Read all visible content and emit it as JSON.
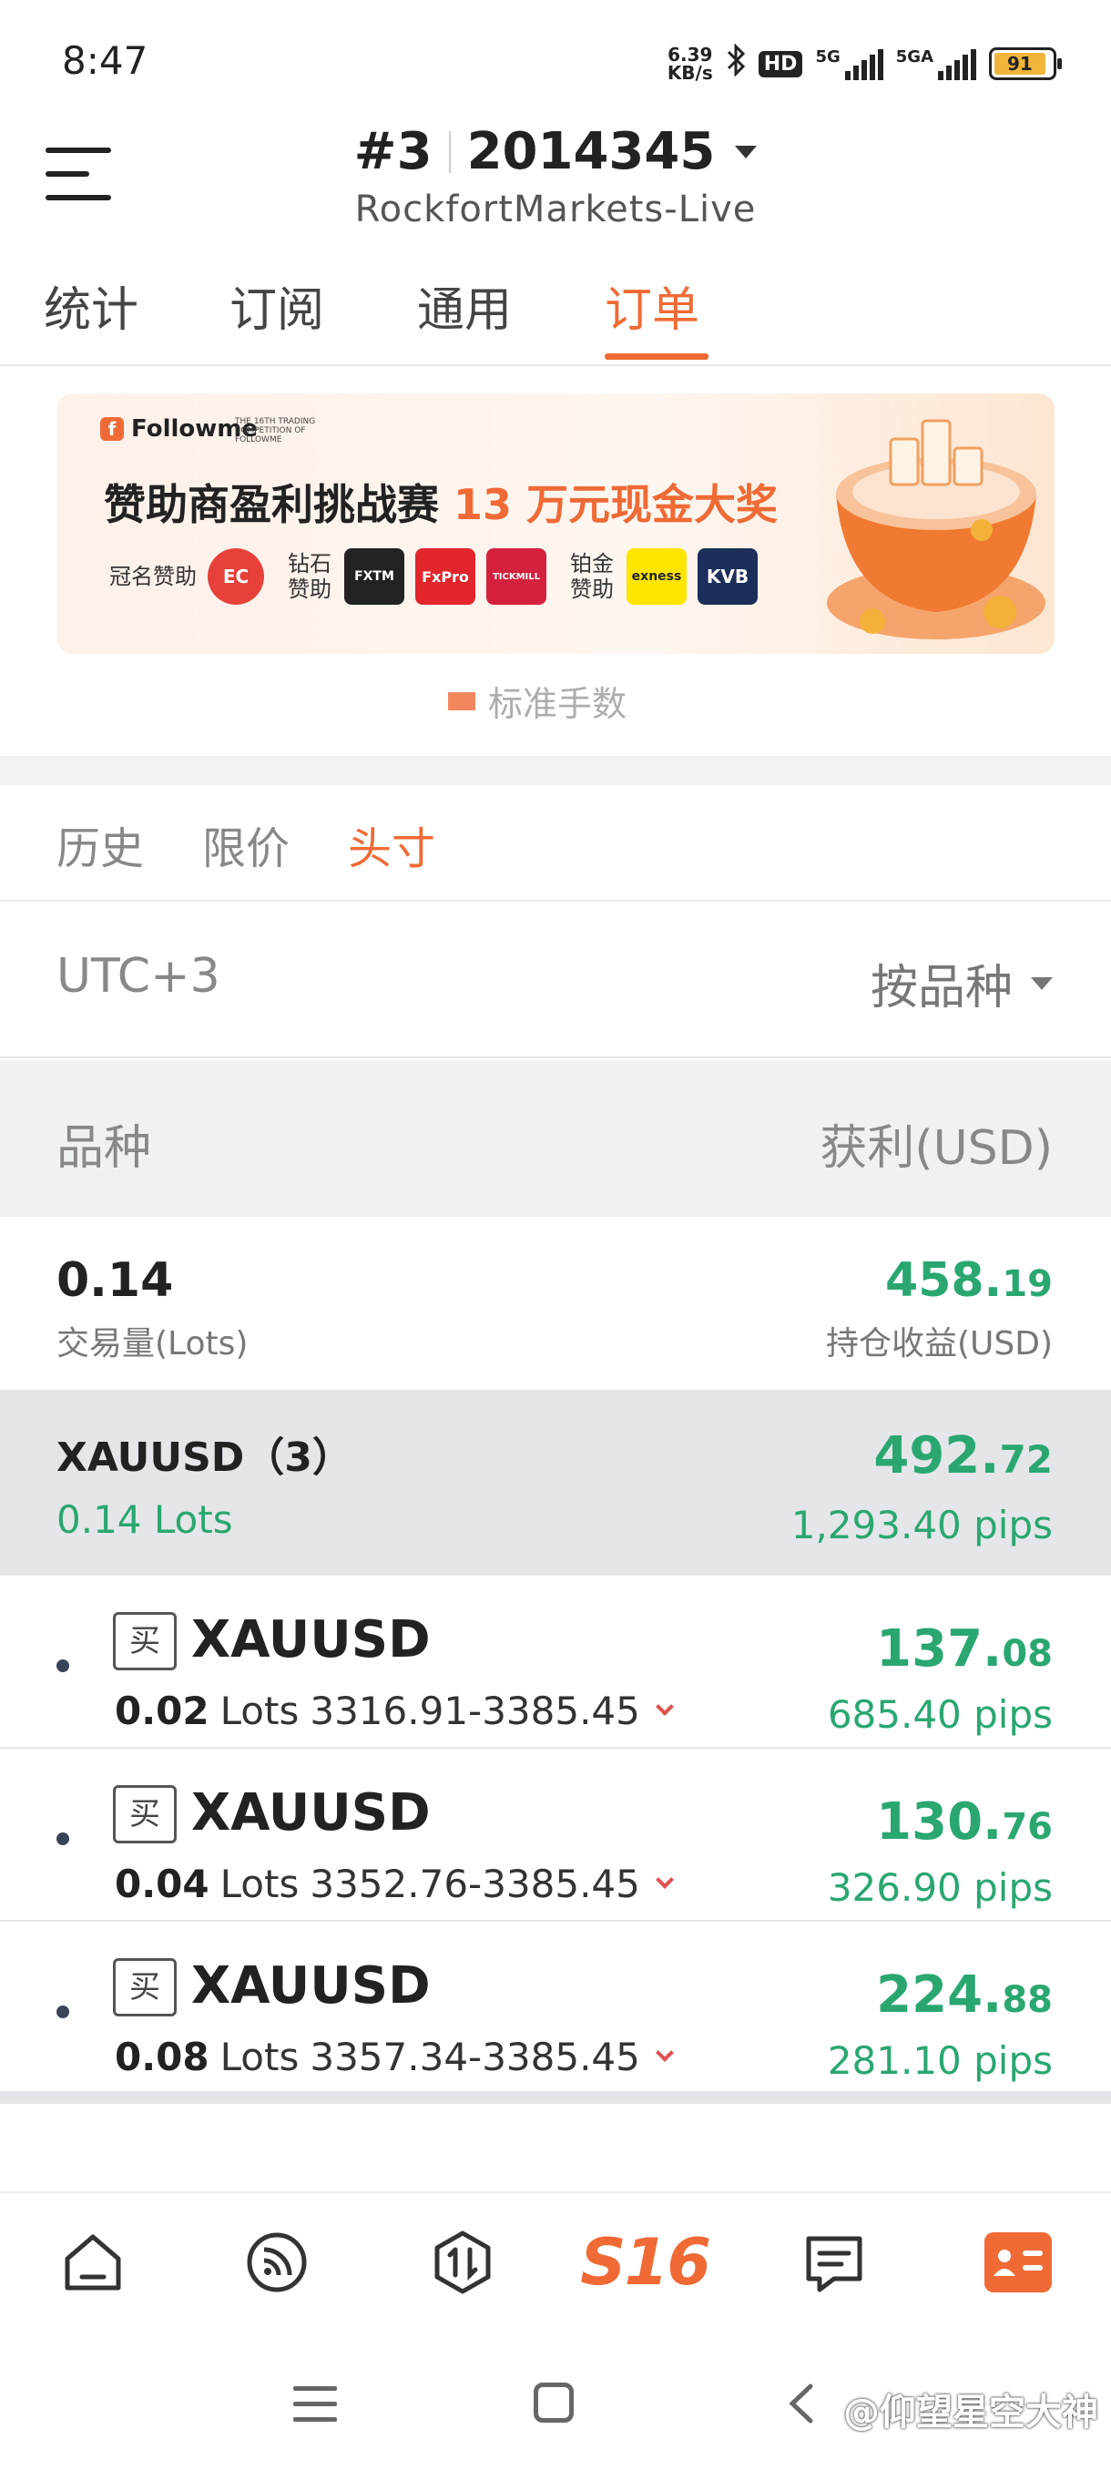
{
  "status_bar": {
    "time": "8:47",
    "net_speed_value": "6.39",
    "net_speed_unit": "KB/s",
    "hd_label": "HD",
    "sim1_label": "5G",
    "sim2_label": "5GA",
    "battery": "91"
  },
  "header": {
    "account_index": "#3",
    "account_number": "2014345",
    "server": "RockfortMarkets-Live"
  },
  "tabs": [
    {
      "label": "统计"
    },
    {
      "label": "订阅"
    },
    {
      "label": "通用"
    },
    {
      "label": "订单"
    }
  ],
  "active_tab": "订单",
  "banner": {
    "brand": "Followme",
    "brand_badge": "f",
    "competition_tag": "THE 16TH TRADING COMPETITION OF FOLLOWME",
    "title_part1": "赞助商盈利挑战赛",
    "title_highlight": "13 万元现金大奖",
    "title_sponsor_label": "冠名赞助",
    "diamond_label": "钻石赞助",
    "platinum_label": "铂金赞助",
    "sponsors": [
      "EC",
      "FXTM",
      "FxPro",
      "TICKMILL",
      "exness",
      "KVB"
    ]
  },
  "faded_legend": "标准手数",
  "sub_tabs": [
    {
      "label": "历史"
    },
    {
      "label": "限价"
    },
    {
      "label": "头寸"
    }
  ],
  "active_sub_tab": "头寸",
  "filter": {
    "timezone": "UTC+3",
    "group_by": "按品种"
  },
  "columns": {
    "symbol": "品种",
    "profit": "获利(USD)"
  },
  "summary": {
    "volume": "0.14",
    "volume_label": "交易量(Lots)",
    "pnl_int": "458.",
    "pnl_dec": "19",
    "pnl_label": "持仓收益(USD)"
  },
  "group": {
    "symbol": "XAUUSD（3）",
    "lots": "0.14 Lots",
    "pnl_int": "492.",
    "pnl_dec": "72",
    "pips": "1,293.40 pips"
  },
  "positions": [
    {
      "side": "买",
      "symbol": "XAUUSD",
      "lots": "0.02",
      "lots_unit": "Lots",
      "range": "3316.91-3385.45",
      "pnl_int": "137.",
      "pnl_dec": "08",
      "pips": "685.40 pips"
    },
    {
      "side": "买",
      "symbol": "XAUUSD",
      "lots": "0.04",
      "lots_unit": "Lots",
      "range": "3352.76-3385.45",
      "pnl_int": "130.",
      "pnl_dec": "76",
      "pips": "326.90 pips"
    },
    {
      "side": "买",
      "symbol": "XAUUSD",
      "lots": "0.08",
      "lots_unit": "Lots",
      "range": "3357.34-3385.45",
      "pnl_int": "224.",
      "pnl_dec": "88",
      "pips": "281.10 pips"
    }
  ],
  "bottom_nav": [
    {
      "icon": "home-icon"
    },
    {
      "icon": "signal-feed-icon"
    },
    {
      "icon": "trade-icon"
    },
    {
      "label": "S16"
    },
    {
      "icon": "message-icon"
    },
    {
      "icon": "profile-card-icon"
    }
  ],
  "watermark": "@仰望星空大神",
  "colors": {
    "accent": "#f06a35",
    "profit_green": "#2aa771",
    "loss_red": "#e05050"
  }
}
